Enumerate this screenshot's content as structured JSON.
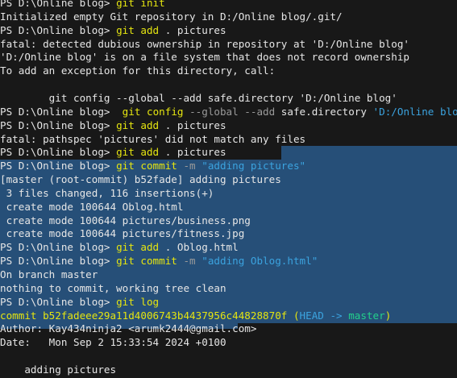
{
  "colors": {
    "background": "#181818",
    "selection": "#264f78",
    "text": "#cccccc",
    "command": "#e5e510",
    "string": "#3ba3df",
    "branch": "#23d18b"
  },
  "terminal": {
    "lines": [
      {
        "segments": [
          {
            "t": "PS D:\\Online blog> ",
            "c": "white"
          },
          {
            "t": "git init",
            "c": "yellow"
          }
        ]
      },
      {
        "segments": [
          {
            "t": "Initialized empty Git repository in D:/Online blog/.git/",
            "c": "white"
          }
        ]
      },
      {
        "segments": [
          {
            "t": "PS D:\\Online blog> ",
            "c": "white"
          },
          {
            "t": "git add",
            "c": "yellow"
          },
          {
            "t": " . pictures",
            "c": "white"
          }
        ]
      },
      {
        "segments": [
          {
            "t": "fatal: detected dubious ownership in repository at 'D:/Online blog'",
            "c": "white"
          }
        ]
      },
      {
        "segments": [
          {
            "t": "'D:/Online blog' is on a file system that does not record ownership",
            "c": "white"
          }
        ]
      },
      {
        "segments": [
          {
            "t": "To add an exception for this directory, call:",
            "c": "white"
          }
        ]
      },
      {
        "segments": [
          {
            "t": "",
            "c": "white"
          }
        ]
      },
      {
        "segments": [
          {
            "t": "        git config --global --add safe.directory 'D:/Online blog'",
            "c": "white"
          }
        ]
      },
      {
        "segments": [
          {
            "t": "PS D:\\Online blog>  ",
            "c": "white"
          },
          {
            "t": "git config",
            "c": "yellow"
          },
          {
            "t": " --global --add",
            "c": "gray"
          },
          {
            "t": " safe.directory ",
            "c": "white"
          },
          {
            "t": "'D:/Online blog'",
            "c": "cyan"
          }
        ]
      },
      {
        "segments": [
          {
            "t": "PS D:\\Online blog> ",
            "c": "white"
          },
          {
            "t": "git add",
            "c": "yellow"
          },
          {
            "t": " . pictures",
            "c": "white"
          }
        ]
      },
      {
        "segments": [
          {
            "t": "fatal: pathspec 'pictures' did not match any files",
            "c": "white"
          }
        ]
      },
      {
        "segments": [
          {
            "t": "PS D:\\Online blog> ",
            "c": "white"
          },
          {
            "t": "git add",
            "c": "yellow"
          },
          {
            "t": " . pictures",
            "c": "white"
          }
        ],
        "sel": "partial"
      },
      {
        "segments": [
          {
            "t": "PS D:\\Online blog> ",
            "c": "white"
          },
          {
            "t": "git commit",
            "c": "yellow"
          },
          {
            "t": " -m ",
            "c": "gray"
          },
          {
            "t": "\"adding pictures\"",
            "c": "cyan"
          }
        ],
        "sel": "full"
      },
      {
        "segments": [
          {
            "t": "[master (root-commit) b52fade] adding pictures",
            "c": "white"
          }
        ],
        "sel": "full"
      },
      {
        "segments": [
          {
            "t": " 3 files changed, 116 insertions(+)",
            "c": "white"
          }
        ],
        "sel": "full"
      },
      {
        "segments": [
          {
            "t": " create mode 100644 Oblog.html",
            "c": "white"
          }
        ],
        "sel": "full"
      },
      {
        "segments": [
          {
            "t": " create mode 100644 pictures/business.png",
            "c": "white"
          }
        ],
        "sel": "full"
      },
      {
        "segments": [
          {
            "t": " create mode 100644 pictures/fitness.jpg",
            "c": "white"
          }
        ],
        "sel": "full"
      },
      {
        "segments": [
          {
            "t": "PS D:\\Online blog> ",
            "c": "white"
          },
          {
            "t": "git add",
            "c": "yellow"
          },
          {
            "t": " . Oblog.html",
            "c": "white"
          }
        ],
        "sel": "full"
      },
      {
        "segments": [
          {
            "t": "PS D:\\Online blog> ",
            "c": "white"
          },
          {
            "t": "git commit",
            "c": "yellow"
          },
          {
            "t": " -m ",
            "c": "gray"
          },
          {
            "t": "\"adding Oblog.html\"",
            "c": "cyan"
          }
        ],
        "sel": "full"
      },
      {
        "segments": [
          {
            "t": "On branch master",
            "c": "white"
          }
        ],
        "sel": "full"
      },
      {
        "segments": [
          {
            "t": "nothing to commit, working tree clean",
            "c": "white"
          }
        ],
        "sel": "full"
      },
      {
        "segments": [
          {
            "t": "PS D:\\Online blog> ",
            "c": "white"
          },
          {
            "t": "git log",
            "c": "yellow"
          }
        ],
        "sel": "full"
      },
      {
        "segments": [
          {
            "t": "commit b52fadeee29a11d4006743b4437956c44828870f (",
            "c": "yellow"
          },
          {
            "t": "HEAD -> ",
            "c": "cyan"
          },
          {
            "t": "master",
            "c": "green"
          },
          {
            "t": ")",
            "c": "yellow"
          }
        ],
        "sel": "full"
      },
      {
        "segments": [
          {
            "t": "Author: Kay434ninja2 <arumk2444@gmail.com>",
            "c": "white"
          }
        ],
        "sel": "partial2"
      },
      {
        "segments": [
          {
            "t": "Date:   Mon Sep 2 15:33:54 2024 +0100",
            "c": "white"
          }
        ]
      },
      {
        "segments": [
          {
            "t": "",
            "c": "white"
          }
        ]
      },
      {
        "segments": [
          {
            "t": "    adding pictures",
            "c": "white"
          }
        ]
      }
    ]
  }
}
